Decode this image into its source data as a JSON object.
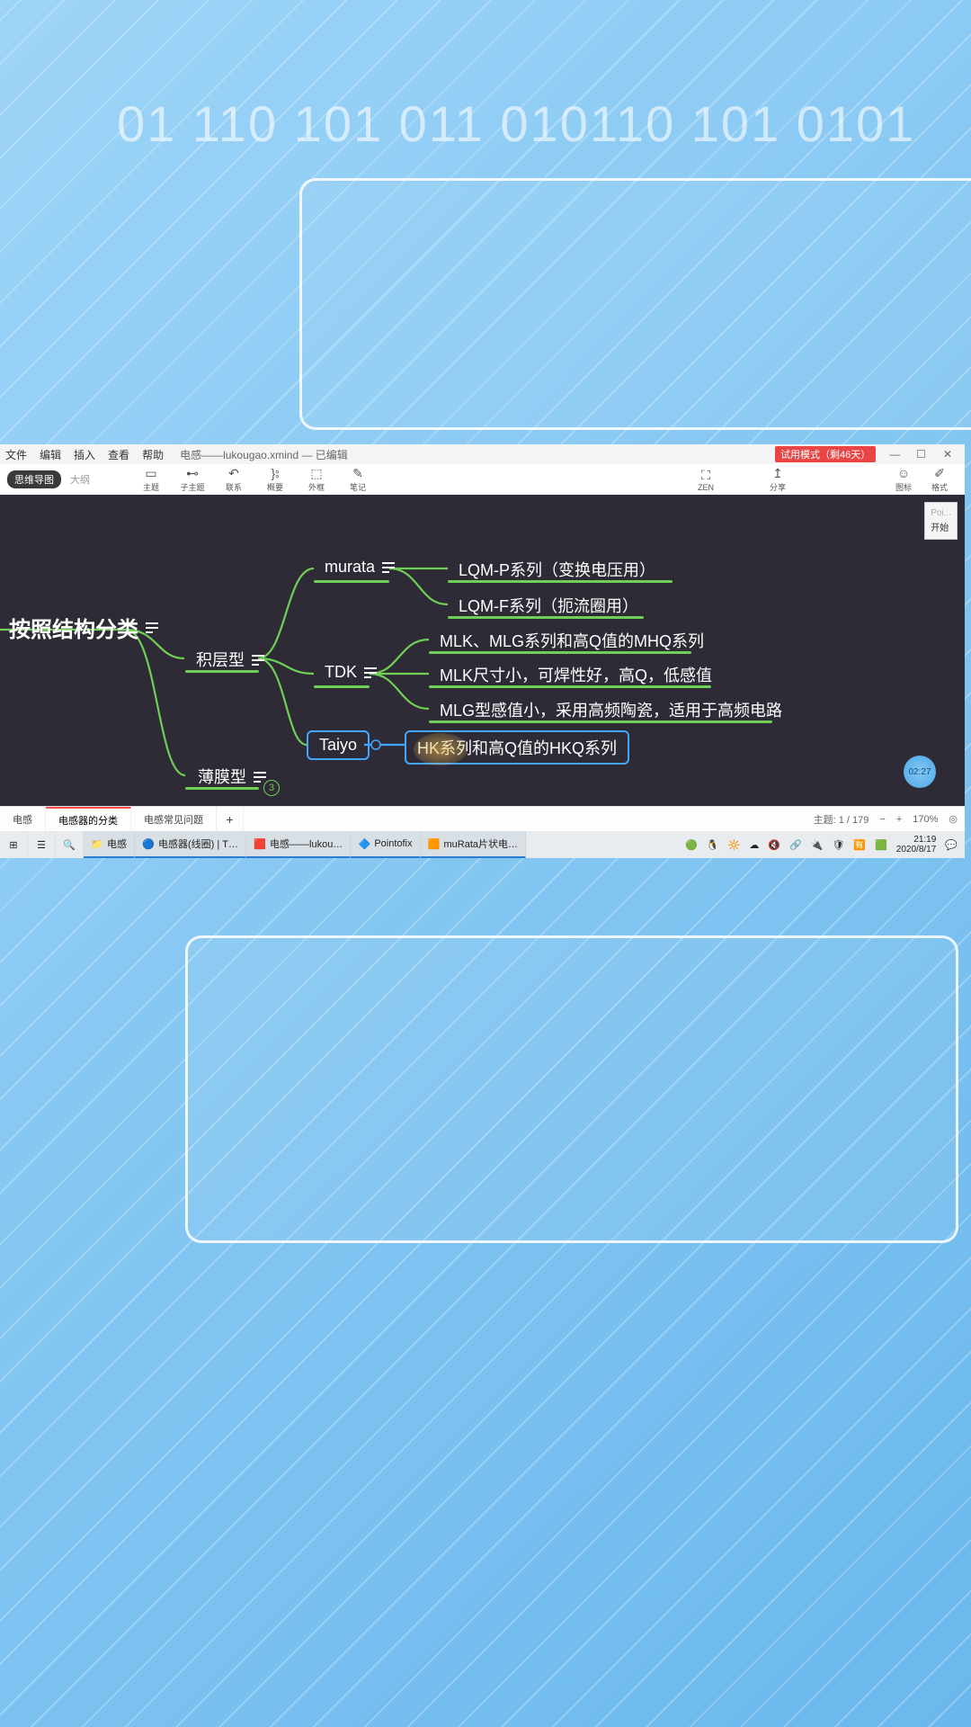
{
  "background": {
    "digits": "01  110   101   011   010110   101   0101"
  },
  "app": {
    "menus": [
      "文件",
      "编辑",
      "插入",
      "查看",
      "帮助"
    ],
    "file_badge": "电感——lukougao.xmind — 已编辑",
    "trial": "试用模式（剩46天）",
    "view_tabs": {
      "active": "思维导图",
      "inactive": "大纲"
    },
    "toolbar": {
      "topic": "主题",
      "subtopic": "子主题",
      "relation": "联系",
      "summary": "概要",
      "boundary": "外框",
      "note": "笔记",
      "zen": "ZEN",
      "share": "分享",
      "image": "图标",
      "style": "格式"
    },
    "start_box": {
      "line1": "Poi...",
      "line2": "开始"
    },
    "play_time": "02:27",
    "mindmap": {
      "root": "按照结构分类",
      "l1a": "积层型",
      "l1b": "薄膜型",
      "l1b_child_count": "3",
      "murata": "murata",
      "tdk": "TDK",
      "taiyo": "Taiyo",
      "lqmp": "LQM-P系列（变换电压用）",
      "lqmf": "LQM-F系列（扼流圈用）",
      "mlk1": "MLK、MLG系列和高Q值的MHQ系列",
      "mlk2": "MLK尺寸小，可焊性好，高Q，低感值",
      "mlg": "MLG型感值小，采用高频陶瓷，适用于高频电路",
      "hk": "HK系列和高Q值的HKQ系列"
    },
    "bottom_tabs": {
      "t1": "电感",
      "t2": "电感器的分类",
      "t3": "电感常见问题"
    },
    "status": {
      "topic": "主题: 1 / 179",
      "zoom": "170%"
    }
  },
  "taskbar": {
    "folder": "电感",
    "items": [
      {
        "ic": "🔵",
        "label": "电感器(线圈) | T…"
      },
      {
        "ic": "🟥",
        "label": "电感——lukou…"
      },
      {
        "ic": "🔷",
        "label": "Pointofix"
      },
      {
        "ic": "🟧",
        "label": "muRata片状电…"
      }
    ],
    "tray_icons": [
      "🟢",
      "🐧",
      "🔆",
      "☁",
      "🔇",
      "🔗",
      "🔌",
      "🛡",
      "🈶",
      "🟩"
    ],
    "clock": {
      "time": "21:19",
      "date": "2020/8/17"
    }
  }
}
